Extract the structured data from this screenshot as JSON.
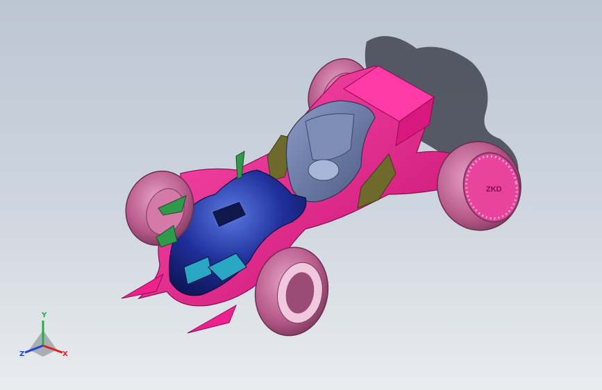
{
  "viewport": {
    "background_top": "#bcc5d3",
    "background_bottom": "#e9ecef"
  },
  "model": {
    "badge_text": "ZKD",
    "colors": {
      "body_pink": "#f0218f",
      "nose_blue": "#1f2f9a",
      "seat_slate": "#6f7ea6",
      "tire_pink": "#c46a98",
      "panel_olive": "#6d6a2c",
      "wing_green": "#2f9a4a",
      "accent_cyan": "#2aa7c4"
    }
  },
  "triad": {
    "x_label": "X",
    "y_label": "Y",
    "z_label": "Z",
    "x_color": "#e02020",
    "y_color": "#20b040",
    "z_color": "#2040e0"
  }
}
